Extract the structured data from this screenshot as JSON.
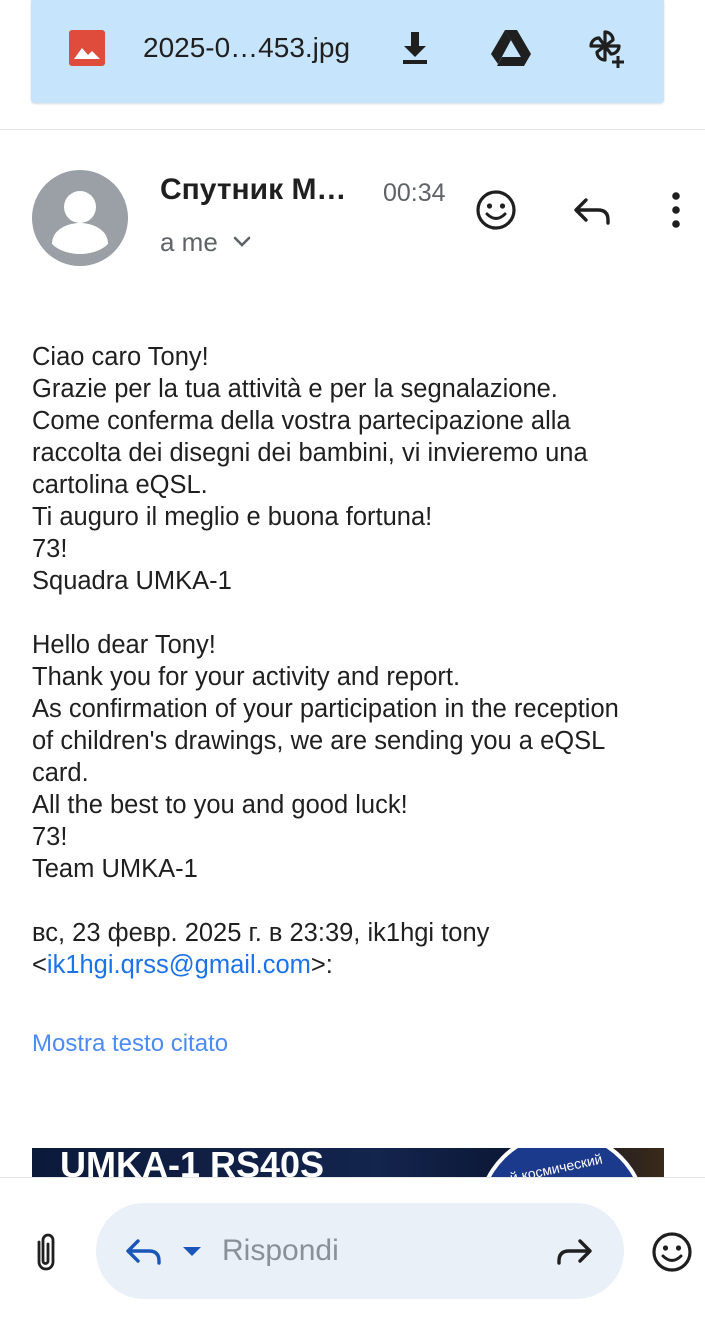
{
  "attachment": {
    "filename": "2025-0…453.jpg",
    "icons": [
      "image-file-icon",
      "download-icon",
      "google-drive-icon",
      "add-to-photos-icon"
    ]
  },
  "message": {
    "sender": "Спутник М…",
    "time": "00:34",
    "recipient": "a me",
    "body_it": [
      "Ciao caro Tony!",
      "Grazie per la tua attività e per la segnalazione.",
      "Come conferma della vostra partecipazione alla",
      "raccolta dei disegni dei bambini, vi invieremo una",
      "cartolina eQSL.",
      "Ti auguro il meglio e buona fortuna!",
      "73!",
      "Squadra UMKA-1"
    ],
    "body_en": [
      "Hello dear Tony!",
      "Thank you for your activity and report.",
      "As confirmation of your participation in the reception",
      "of children's drawings, we are sending you a eQSL",
      "card.",
      "All the best to you and good luck!",
      "73!",
      "Team UMKA-1"
    ],
    "quote_header": {
      "line1": "вс, 23 февр. 2025 г. в 23:39, ik1hgi tony",
      "lt": "<",
      "email": "ik1hgi.qrss@gmail.com",
      "gt_colon": ">:"
    },
    "show_quoted": "Mostra testo citato",
    "embedded_image_text": "UMKA-1 RS40S",
    "embedded_badge_text": "й космический"
  },
  "reply_bar": {
    "placeholder": "Rispondi"
  },
  "colors": {
    "attachment_bar": "#c6e4fb",
    "link": "#1a73e8",
    "show_quoted": "#4c8bf5",
    "avatar": "#9aa0a6",
    "reply_pill": "#eaf0f7"
  }
}
